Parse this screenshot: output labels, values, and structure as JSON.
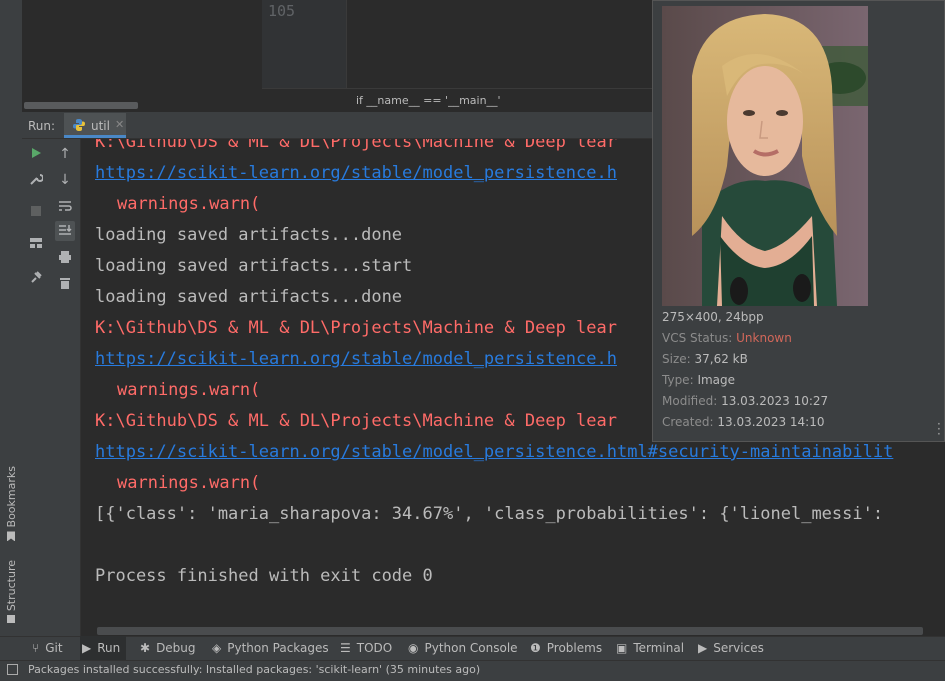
{
  "sidebar": {
    "bookmarks_label": "Bookmarks",
    "structure_label": "Structure"
  },
  "editor": {
    "line_number": "105",
    "breadcrumb": "if __name__ == '__main__'"
  },
  "run_panel": {
    "label": "Run:",
    "tab_name": "util"
  },
  "console_lines": [
    {
      "text": "K:\\Github\\DS & ML & DL\\Projects\\Machine & Deep lear",
      "kind": "err",
      "indent": false
    },
    {
      "text": "https://scikit-learn.org/stable/model_persistence.h",
      "kind": "link",
      "indent": false
    },
    {
      "text": "warnings.warn(",
      "kind": "err",
      "indent": true
    },
    {
      "text": "loading saved artifacts...done",
      "kind": "out",
      "indent": false
    },
    {
      "text": "loading saved artifacts...start",
      "kind": "out",
      "indent": false
    },
    {
      "text": "loading saved artifacts...done",
      "kind": "out",
      "indent": false
    },
    {
      "text": "K:\\Github\\DS & ML & DL\\Projects\\Machine & Deep lear",
      "kind": "err",
      "indent": false
    },
    {
      "text": "https://scikit-learn.org/stable/model_persistence.h",
      "kind": "link",
      "indent": false
    },
    {
      "text": "warnings.warn(",
      "kind": "err",
      "indent": true
    },
    {
      "text": "K:\\Github\\DS & ML & DL\\Projects\\Machine & Deep lear",
      "kind": "err",
      "indent": false
    },
    {
      "text": "https://scikit-learn.org/stable/model_persistence.html#security-maintainabilit",
      "kind": "link",
      "indent": false
    },
    {
      "text": "warnings.warn(",
      "kind": "err",
      "indent": true
    },
    {
      "text": "[{'class': 'maria_sharapova: 34.67%', 'class_probabilities': {'lionel_messi':",
      "kind": "out",
      "indent": false
    },
    {
      "text": "",
      "kind": "out",
      "indent": false
    },
    {
      "text": "Process finished with exit code 0",
      "kind": "out",
      "indent": false
    }
  ],
  "image_popup": {
    "dimensions": "275×400, 24bpp",
    "vcs_label": "VCS Status:",
    "vcs_value": "Unknown",
    "size_label": "Size:",
    "size_value": "37,62 kB",
    "type_label": "Type:",
    "type_value": "Image",
    "modified_label": "Modified:",
    "modified_value": "13.03.2023 10:27",
    "created_label": "Created:",
    "created_value": "13.03.2023 14:10"
  },
  "bottom_tabs": [
    {
      "label": "Git",
      "icon": "git-branch-icon"
    },
    {
      "label": "Run",
      "icon": "run-icon"
    },
    {
      "label": "Debug",
      "icon": "bug-icon"
    },
    {
      "label": "Python Packages",
      "icon": "packages-icon"
    },
    {
      "label": "TODO",
      "icon": "todo-icon"
    },
    {
      "label": "Python Console",
      "icon": "python-console-icon"
    },
    {
      "label": "Problems",
      "icon": "problems-icon"
    },
    {
      "label": "Terminal",
      "icon": "terminal-icon"
    },
    {
      "label": "Services",
      "icon": "services-icon"
    }
  ],
  "status_bar": {
    "message": "Packages installed successfully: Installed packages: 'scikit-learn' (35 minutes ago)"
  },
  "colors": {
    "error": "#ff6b68",
    "link": "#287bde",
    "output": "#bbbbbb",
    "vcs_unknown": "#d1675a",
    "run_icon": "#59a869"
  }
}
